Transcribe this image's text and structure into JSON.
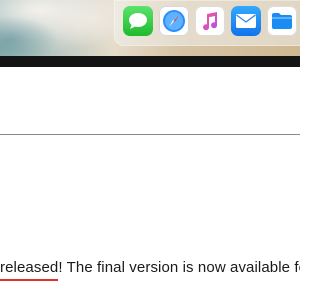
{
  "dock": {
    "apps": [
      {
        "name": "messages-icon",
        "color": "#22c234"
      },
      {
        "name": "safari-icon",
        "color": "#1e88ff"
      },
      {
        "name": "music-icon",
        "color": "#fa3c5a"
      },
      {
        "name": "mail-icon",
        "color": "#1a7cf0"
      },
      {
        "name": "files-icon",
        "color": "#1c8cf5"
      }
    ]
  },
  "document": {
    "underlined_word": "released",
    "line_rest": "! The final version is now available for us"
  },
  "colors": {
    "spellcheck_underline": "#e0312a",
    "top_bar": "#141414",
    "divider": "#8a8a8a"
  }
}
